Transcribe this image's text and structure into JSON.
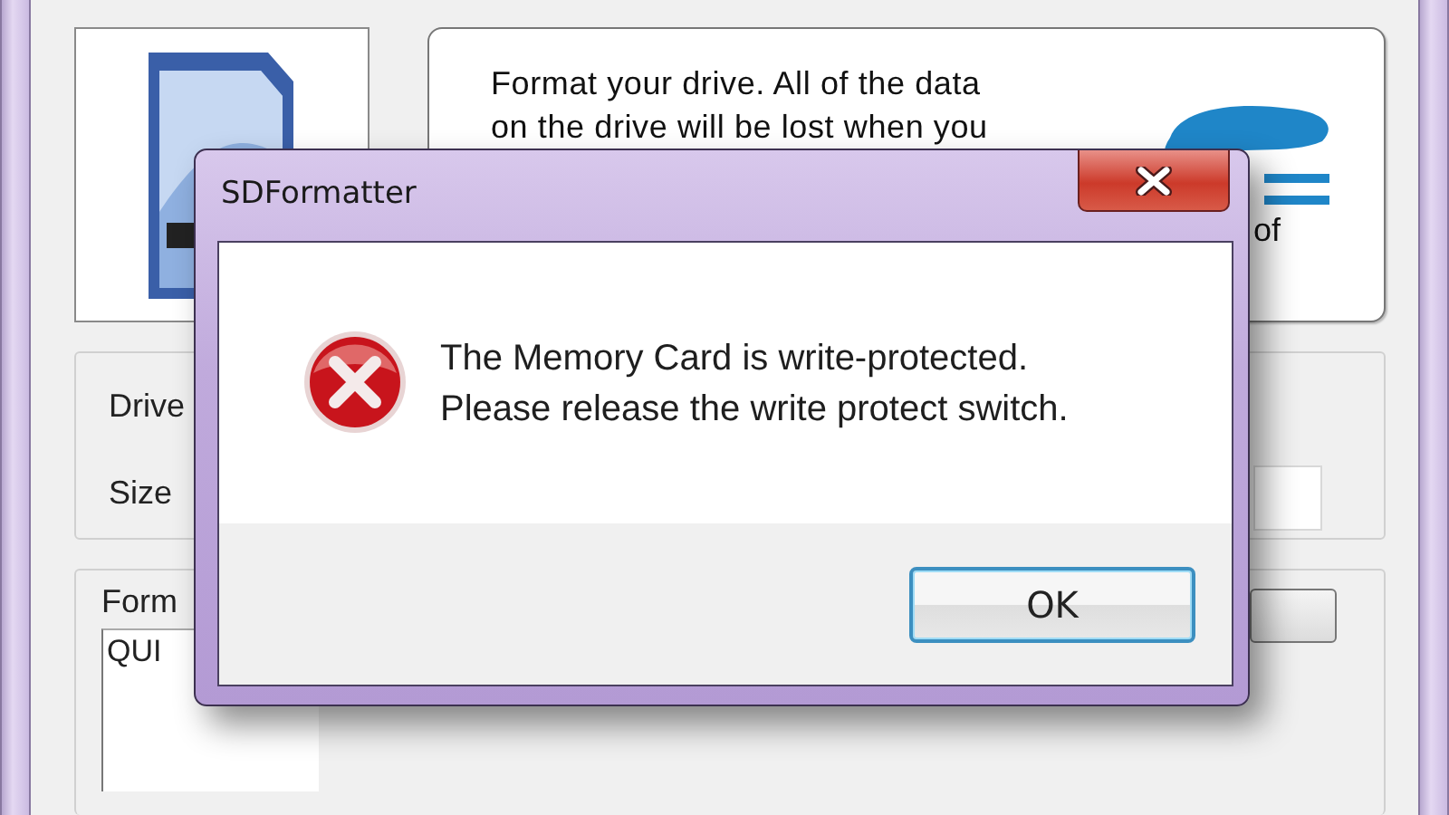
{
  "app": {
    "description": [
      "Format your drive. All of the data",
      "on the drive will be lost when you"
    ],
    "description_tail": "of",
    "drive_label": "Drive",
    "size_label": "Size",
    "format_label": "Form",
    "format_value": "QUI"
  },
  "dialog": {
    "title": "SDFormatter",
    "message": [
      "The Memory Card is write-protected.",
      "Please release the write protect switch."
    ],
    "buttons": [
      {
        "label": "OK",
        "default": true
      }
    ]
  }
}
